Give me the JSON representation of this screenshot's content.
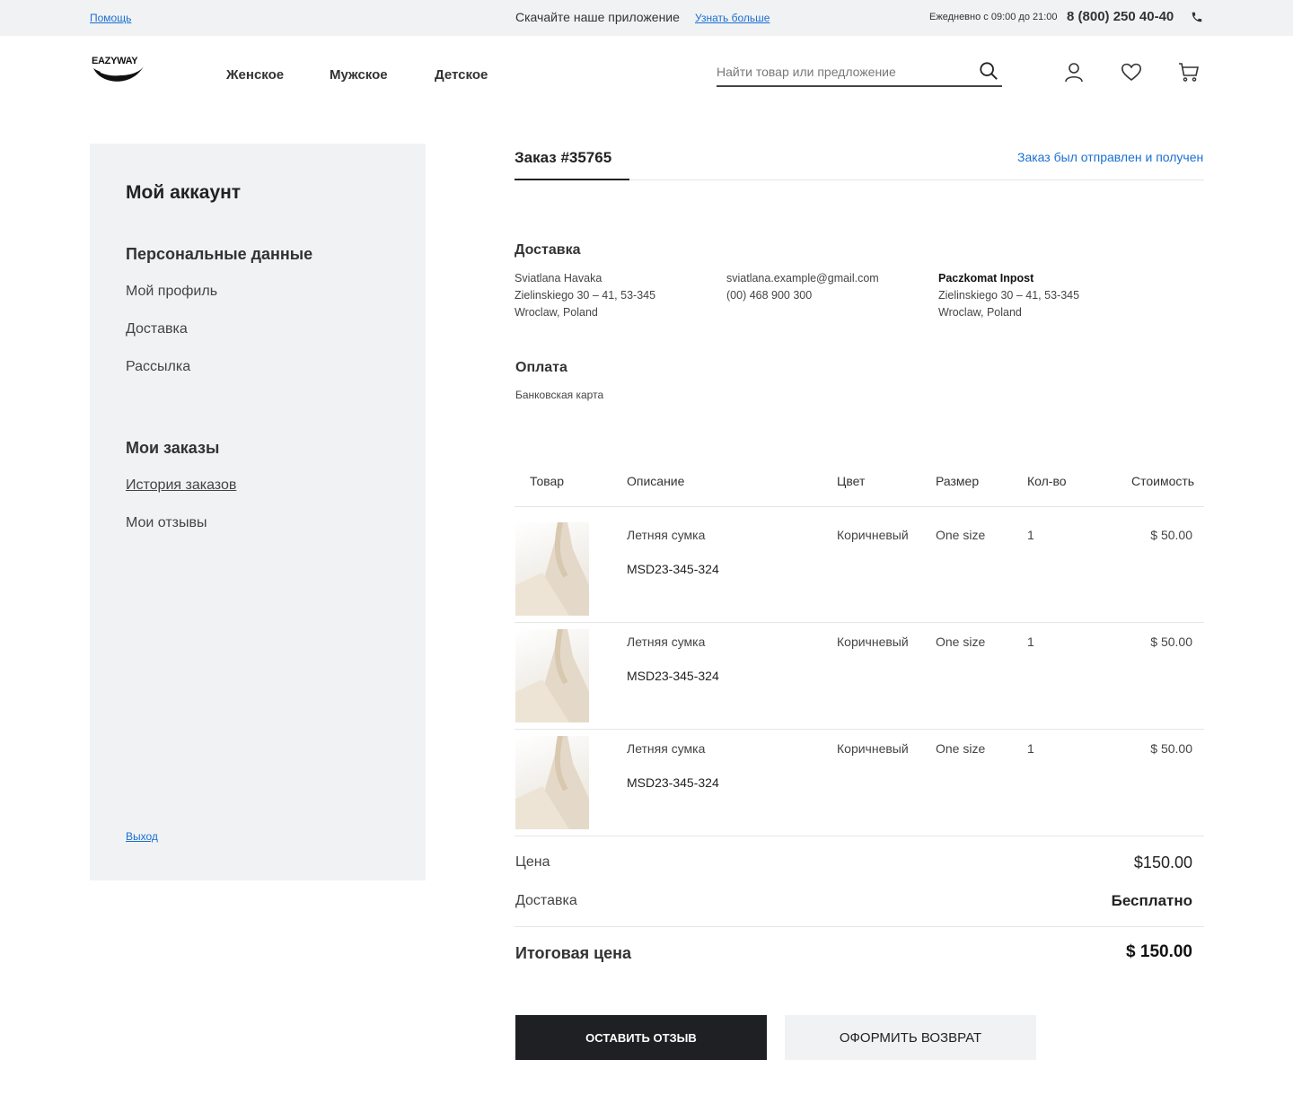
{
  "topbar": {
    "help": "Помощь",
    "promo": "Скачайте наше приложение",
    "promo_link": "Узнать больше",
    "hours": "Ежедневно с 09:00 до 21:00",
    "phone": "8 (800) 250 40-40"
  },
  "header": {
    "logo": "EAZYWAY",
    "nav": [
      "Женское",
      "Мужское",
      "Детское"
    ],
    "search_placeholder": "Найти товар или предложение"
  },
  "sidebar": {
    "title": "Мой аккаунт",
    "section1": "Персональные данные",
    "section1_items": [
      "Мой профиль",
      "Доставка",
      "Рассылка"
    ],
    "section2": "Мои заказы",
    "section2_items": [
      "История заказов",
      "Мои отзывы"
    ],
    "logout": "Выход"
  },
  "order": {
    "tab": "Заказ #35765",
    "status": "Заказ был отправлен и получен",
    "delivery_title": "Доставка",
    "recipient": [
      "Sviatlana Havaka",
      "Zielinskiego 30 – 41, 53-345",
      "Wroclaw, Poland"
    ],
    "contacts": [
      "sviatlana.example@gmail.com",
      "(00) 468 900 300"
    ],
    "pickup_name": "Paczkomat Inpost",
    "pickup_addr": [
      "Zielinskiego 30 – 41, 53-345",
      "Wroclaw, Poland"
    ],
    "payment_title": "Оплата",
    "payment_method": "Банковская карта"
  },
  "table": {
    "headers": [
      "Товар",
      "Описание",
      "Цвет",
      "Размер",
      "Кол-во",
      "Стоимость"
    ],
    "rows": [
      {
        "name": "Летняя сумка",
        "sku": "MSD23-345-324",
        "color": "Коричневый",
        "size": "One size",
        "qty": "1",
        "price": "$ 50.00"
      },
      {
        "name": "Летняя сумка",
        "sku": "MSD23-345-324",
        "color": "Коричневый",
        "size": "One size",
        "qty": "1",
        "price": "$ 50.00"
      },
      {
        "name": "Летняя сумка",
        "sku": "MSD23-345-324",
        "color": "Коричневый",
        "size": "One size",
        "qty": "1",
        "price": "$ 50.00"
      }
    ]
  },
  "summary": {
    "price_label": "Цена",
    "price_value": "$150.00",
    "shipping_label": "Доставка",
    "shipping_value": "Бесплатно",
    "total_label": "Итоговая цена",
    "total_value": "$ 150.00"
  },
  "buttons": {
    "review": "ОСТАВИТЬ ОТЗЫВ",
    "return": "ОФОРМИТЬ ВОЗВРАТ"
  },
  "colors": {
    "accent": "#1a6fd1",
    "panel": "#f1f2f4",
    "dark_button": "#1f2023"
  }
}
